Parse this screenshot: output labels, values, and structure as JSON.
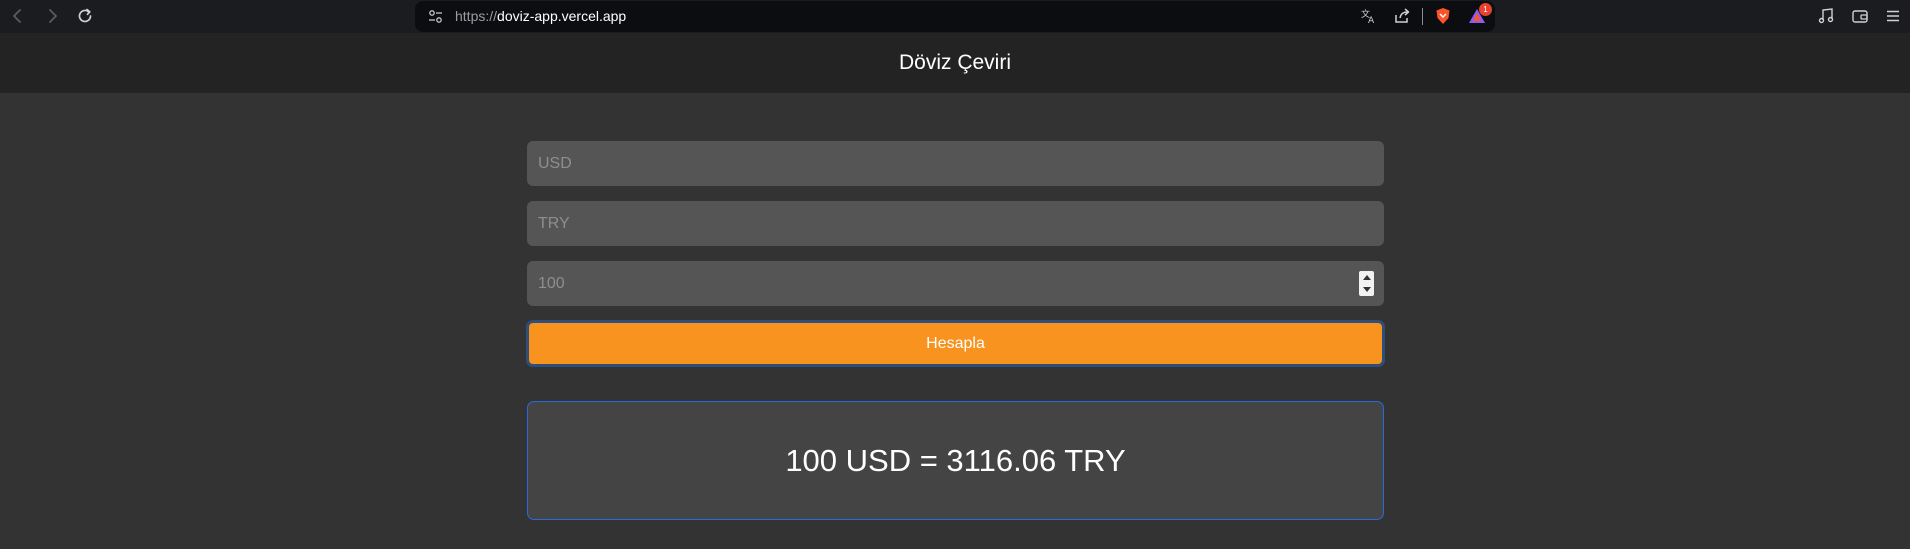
{
  "browser": {
    "url_scheme": "https://",
    "url_host": "doviz-app.vercel.app",
    "notification_count": "1",
    "accent_color": "#f7931e"
  },
  "app": {
    "title": "Döviz Çeviri"
  },
  "form": {
    "from_currency": {
      "value": "",
      "placeholder": "USD"
    },
    "to_currency": {
      "value": "",
      "placeholder": "TRY"
    },
    "amount": {
      "value": "",
      "placeholder": "100"
    },
    "submit_label": "Hesapla"
  },
  "result": {
    "text": "100 USD = 3116.06 TRY"
  },
  "icons": [
    "back-icon",
    "forward-icon",
    "reload-icon",
    "site-settings-icon",
    "translate-icon",
    "share-icon",
    "brave-shields-icon",
    "brave-rewards-icon",
    "media-icon",
    "wallet-icon",
    "menu-icon"
  ]
}
